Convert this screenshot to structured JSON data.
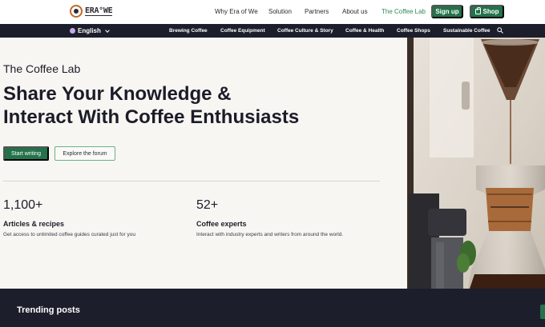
{
  "brand": {
    "logo_text": "ERA°WE"
  },
  "nav": {
    "links": [
      {
        "label": "Why Era of We"
      },
      {
        "label": "Solution"
      },
      {
        "label": "Partners"
      },
      {
        "label": "About us"
      },
      {
        "label": "The Coffee Lab",
        "active": true
      }
    ],
    "signup_label": "Sign up",
    "shop_label": "Shop"
  },
  "category_bar": {
    "language": "English",
    "categories": [
      "Brewing Coffee",
      "Coffee Equipment",
      "Coffee Culture & Story",
      "Coffee & Health",
      "Coffee Shops",
      "Sustainable Coffee"
    ]
  },
  "hero": {
    "label": "The Coffee Lab",
    "title_line1": "Share Your Knowledge &",
    "title_line2": "Interact With Coffee Enthusiasts",
    "primary_button": "Start writing",
    "secondary_button": "Explore the forum",
    "stats": [
      {
        "number": "1,100+",
        "label": "Articles & recipes",
        "description": "Get access to unlimited coffee guides curated just for you"
      },
      {
        "number": "52+",
        "label": "Coffee experts",
        "description": "Interact with industry experts and writers from around the world."
      }
    ]
  },
  "trending": {
    "title": "Trending posts"
  },
  "colors": {
    "brand_green": "#24724b",
    "dark_navy": "#1d1e2c",
    "hero_bg": "#f8f6f3",
    "active_link": "#2e8b57"
  }
}
